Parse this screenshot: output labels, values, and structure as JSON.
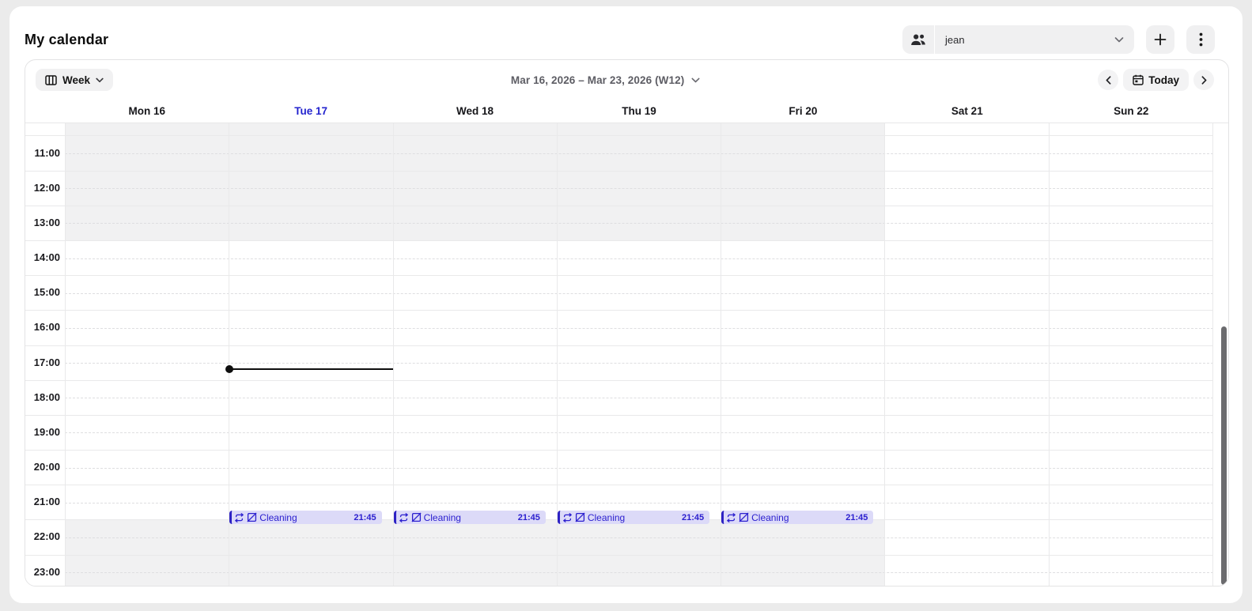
{
  "header": {
    "title": "My calendar",
    "user_filter": {
      "value": "jean",
      "icon": "people-icon"
    },
    "buttons": {
      "add_icon": "plus-icon",
      "more_icon": "kebab-icon"
    }
  },
  "calendar": {
    "toolbar": {
      "view_label": "Week",
      "view_icon": "week-columns-icon",
      "range_label": "Mar 16, 2026 – Mar 23, 2026 (W12)",
      "prev_icon": "chevron-left-icon",
      "next_icon": "chevron-right-icon",
      "today_label": "Today",
      "today_icon": "calendar-icon"
    },
    "days": [
      {
        "label": "Mon 16",
        "today": false,
        "weekday": true
      },
      {
        "label": "Tue 17",
        "today": true,
        "weekday": true
      },
      {
        "label": "Wed 18",
        "today": false,
        "weekday": true
      },
      {
        "label": "Thu 19",
        "today": false,
        "weekday": true
      },
      {
        "label": "Fri 20",
        "today": false,
        "weekday": true
      },
      {
        "label": "Sat 21",
        "today": false,
        "weekday": false
      },
      {
        "label": "Sun 22",
        "today": false,
        "weekday": false
      }
    ],
    "hours": [
      "11:00",
      "12:00",
      "13:00",
      "14:00",
      "15:00",
      "16:00",
      "17:00",
      "18:00",
      "19:00",
      "20:00",
      "21:00",
      "22:00",
      "23:00"
    ],
    "off_hours": {
      "weekday_shaded_before": "14:00",
      "weekday_shaded_after": "22:00"
    },
    "now_indicator": {
      "day": "Tue 17",
      "day_index": 1,
      "time": "17:40"
    },
    "events": [
      {
        "day": "Tue 17",
        "day_index": 1,
        "title": "Cleaning",
        "start": "21:45",
        "time_label": "21:45",
        "icons": [
          "repeat-icon",
          "slash-square-icon"
        ]
      },
      {
        "day": "Wed 18",
        "day_index": 2,
        "title": "Cleaning",
        "start": "21:45",
        "time_label": "21:45",
        "icons": [
          "repeat-icon",
          "slash-square-icon"
        ]
      },
      {
        "day": "Thu 19",
        "day_index": 3,
        "title": "Cleaning",
        "start": "21:45",
        "time_label": "21:45",
        "icons": [
          "repeat-icon",
          "slash-square-icon"
        ]
      },
      {
        "day": "Fri 20",
        "day_index": 4,
        "title": "Cleaning",
        "start": "21:45",
        "time_label": "21:45",
        "icons": [
          "repeat-icon",
          "slash-square-icon"
        ]
      }
    ],
    "colors": {
      "accent_today": "#2323ce",
      "event_bg": "#dcdaf8",
      "event_text": "#2c20cf",
      "event_bar": "#2d22c4",
      "off_hours_shade": "#f1f1f2",
      "now_indicator": "#0e0e0e"
    }
  }
}
